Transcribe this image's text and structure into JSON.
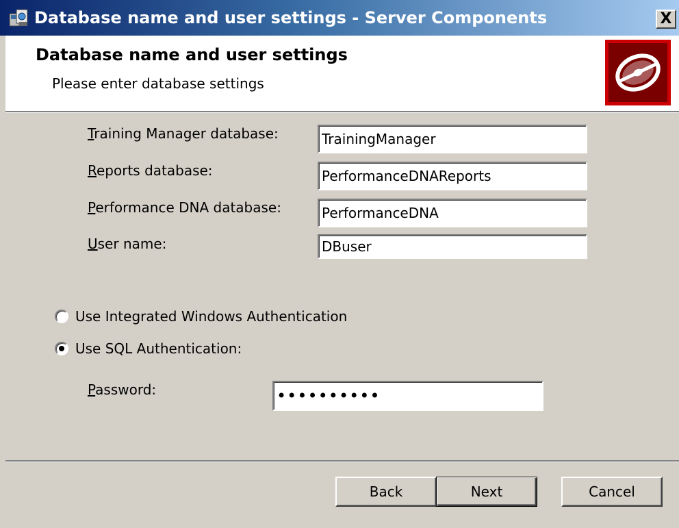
{
  "window": {
    "title": "Database name and user settings - Server Components",
    "close_symbol": "X"
  },
  "header": {
    "title": "Database name and user settings",
    "subtitle": "Please enter database settings",
    "logo_icon": "disc-icon",
    "logo_color": "#cc0000"
  },
  "fields": {
    "training_manager_db": {
      "label_accel": "T",
      "label_rest": "raining Manager database:",
      "value": "TrainingManager"
    },
    "reports_db": {
      "label_accel": "R",
      "label_rest": "eports database:",
      "value": "PerformanceDNAReports"
    },
    "performance_dna_db": {
      "label_accel": "P",
      "label_rest": "erformance DNA database:",
      "value": "PerformanceDNA"
    },
    "user_name": {
      "label_accel": "U",
      "label_rest": "ser name:",
      "value": "DBuser"
    },
    "password": {
      "label_accel": "P",
      "label_rest": "assword:",
      "value": "••••••••••"
    }
  },
  "auth": {
    "windows_label": "Use Integrated Windows Authentication",
    "sql_label": "Use SQL Authentication:",
    "selected": "sql"
  },
  "buttons": {
    "back": "Back",
    "next": "Next",
    "cancel": "Cancel"
  }
}
